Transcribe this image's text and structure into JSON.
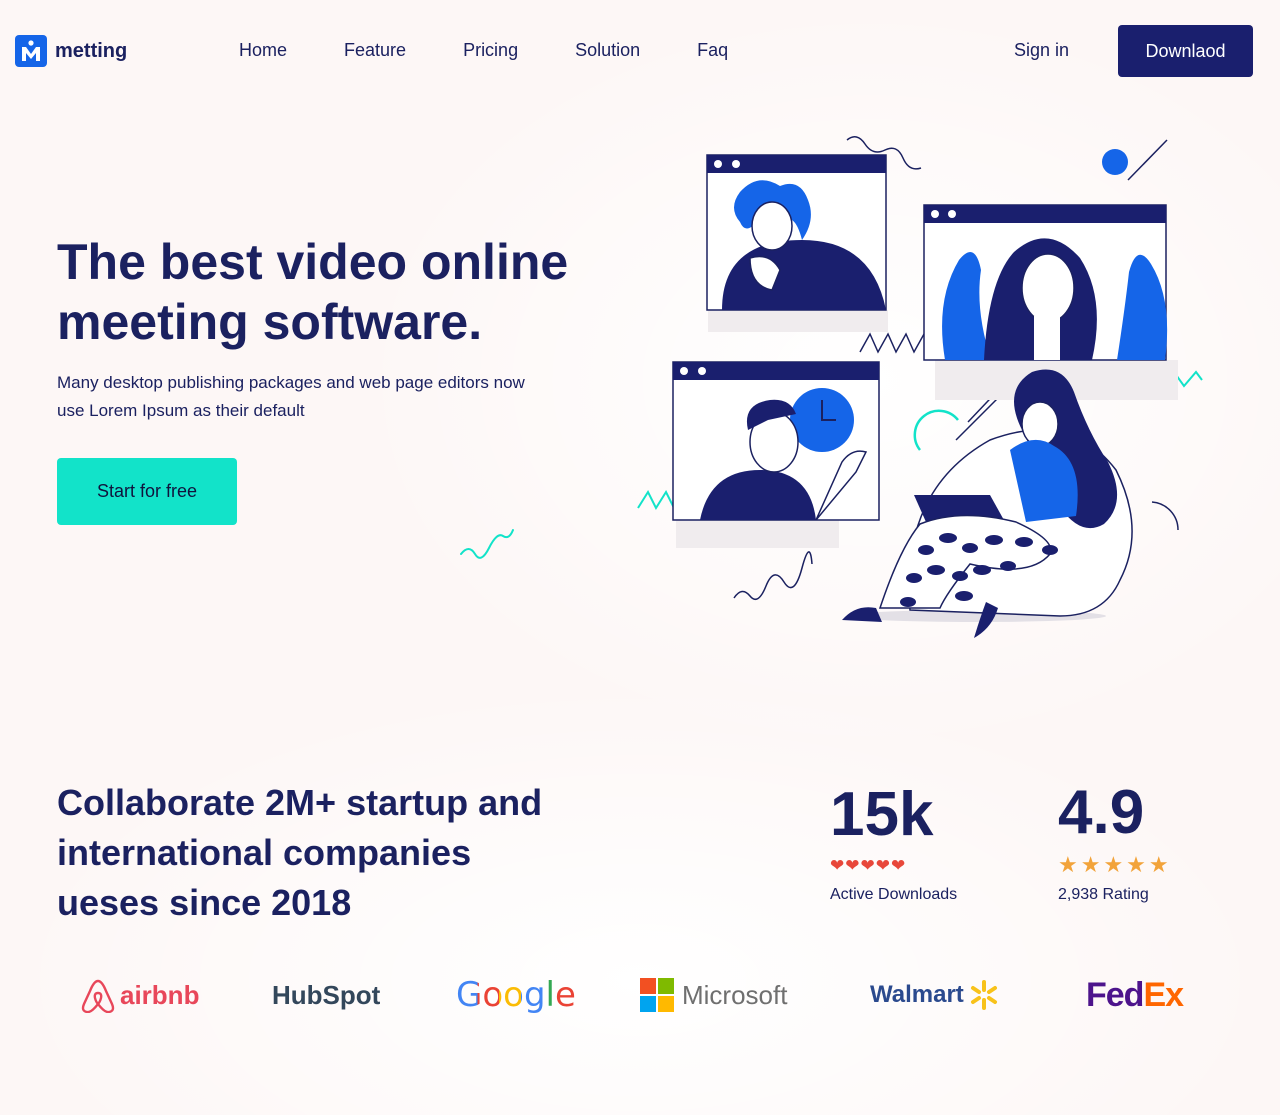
{
  "nav": {
    "logo_text": "metting",
    "links": [
      "Home",
      "Feature",
      "Pricing",
      "Solution",
      "Faq"
    ],
    "signin_label": "Sign in",
    "download_label": "Downlaod"
  },
  "hero": {
    "title": "The best video online meeting software.",
    "description": "Many desktop publishing packages and web page editors now use Lorem Ipsum as their default",
    "cta_label": "Start for free"
  },
  "collab": {
    "text": "Collaborate 2M+ startup and international companies ueses since 2018"
  },
  "stats": [
    {
      "value": "15k",
      "icons": "❤❤❤❤❤",
      "label": "Active Downloads"
    },
    {
      "value": "4.9",
      "icons": "★★★★★",
      "label": "2,938 Rating"
    }
  ],
  "brands": {
    "airbnb": "airbnb",
    "hubspot": "HubSpot",
    "google": "Google",
    "microsoft": "Microsoft",
    "walmart": "Walmart",
    "fedex_a": "Fed",
    "fedex_b": "Ex"
  },
  "colors": {
    "primary": "#1b2160",
    "accent_blue": "#1565e8",
    "accent_teal": "#12e3c9",
    "button_dark": "#1a1f6e",
    "heart": "#e8473a",
    "star": "#f2a33a"
  }
}
